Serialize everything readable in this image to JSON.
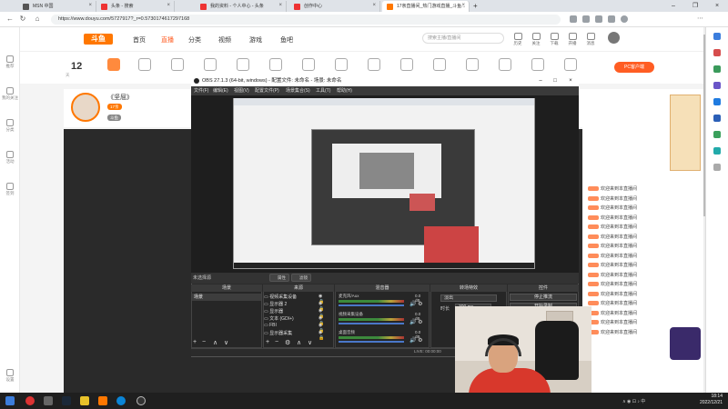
{
  "browser": {
    "tabs": [
      {
        "label": "MSN 中国",
        "active": false
      },
      {
        "label": "头条 - 搜索",
        "active": false
      },
      {
        "label": "我的资料 - 个人中心 - 头条",
        "active": false
      },
      {
        "label": "创作中心",
        "active": false
      },
      {
        "label": "17亲直播间_热门游戏直播_斗鱼...",
        "active": true
      }
    ],
    "new_tab": "+",
    "url": "https://www.douyu.com/5727917?_r=0.5730174617297168"
  },
  "site": {
    "logo": "斗鱼",
    "nav": [
      "首页",
      "直播",
      "分类",
      "视频",
      "游戏",
      "鱼吧"
    ],
    "search_placeholder": "搜索主播/直播间",
    "top_icons": [
      "历史",
      "关注",
      "下载",
      "开播",
      "消息"
    ],
    "sidebar": [
      "推荐",
      "我的关注",
      "分类",
      "活动",
      "签到",
      "设置"
    ],
    "day_count": "12",
    "day_label": "天",
    "pc_button": "PC客户端",
    "room_title": "《坚屈》",
    "follow_button": "关注",
    "tags": [
      "17亲",
      "斗鱼"
    ]
  },
  "chat": {
    "lines": [
      "欢迎来到本直播间",
      "欢迎来到本直播间",
      "欢迎来到本直播间",
      "欢迎来到本直播间",
      "欢迎来到本直播间",
      "欢迎来到本直播间",
      "欢迎来到本直播间",
      "欢迎来到本直播间",
      "欢迎来到本直播间",
      "欢迎来到本直播间",
      "欢迎来到本直播间",
      "欢迎来到本直播间",
      "欢迎来到本直播间",
      "欢迎来到本直播间",
      "欢迎来到本直播间",
      "欢迎来到本直播间"
    ]
  },
  "obs": {
    "title": "OBS 27.1.3 (64-bit, windows) - 配置文件: 未命名 - 场景: 未命名",
    "menu": [
      "文件(F)",
      "编辑(E)",
      "视图(V)",
      "配置文件(P)",
      "场景集合(S)",
      "工具(T)",
      "帮助(H)"
    ],
    "no_source": "未选择源",
    "properties_btn": "属性",
    "filters_btn": "滤镜",
    "docks": {
      "scenes": "场景",
      "sources": "来源",
      "mixer": "混音器",
      "transitions": "转场特效",
      "controls": "控件"
    },
    "scene_item": "场景",
    "sources": [
      "视频采集设备",
      "显示器 2",
      "显示器",
      "文本 (GDI+)",
      "FBI",
      "显示器采集"
    ],
    "mixer": [
      {
        "name": "麦克风/Aux",
        "value": "0.0 dB"
      },
      {
        "name": "视频采集设备",
        "value": "0.0 dB"
      },
      {
        "name": "桌面音频",
        "value": "0.0 dB"
      }
    ],
    "transition": "淡出",
    "duration_label": "时长",
    "duration": "300 ms",
    "controls": [
      "停止推流",
      "开始录制"
    ],
    "status": "LIVE: 00:00:00"
  },
  "taskbar": {
    "time": "18:14",
    "date": "2022/12/21",
    "lang": "中"
  }
}
